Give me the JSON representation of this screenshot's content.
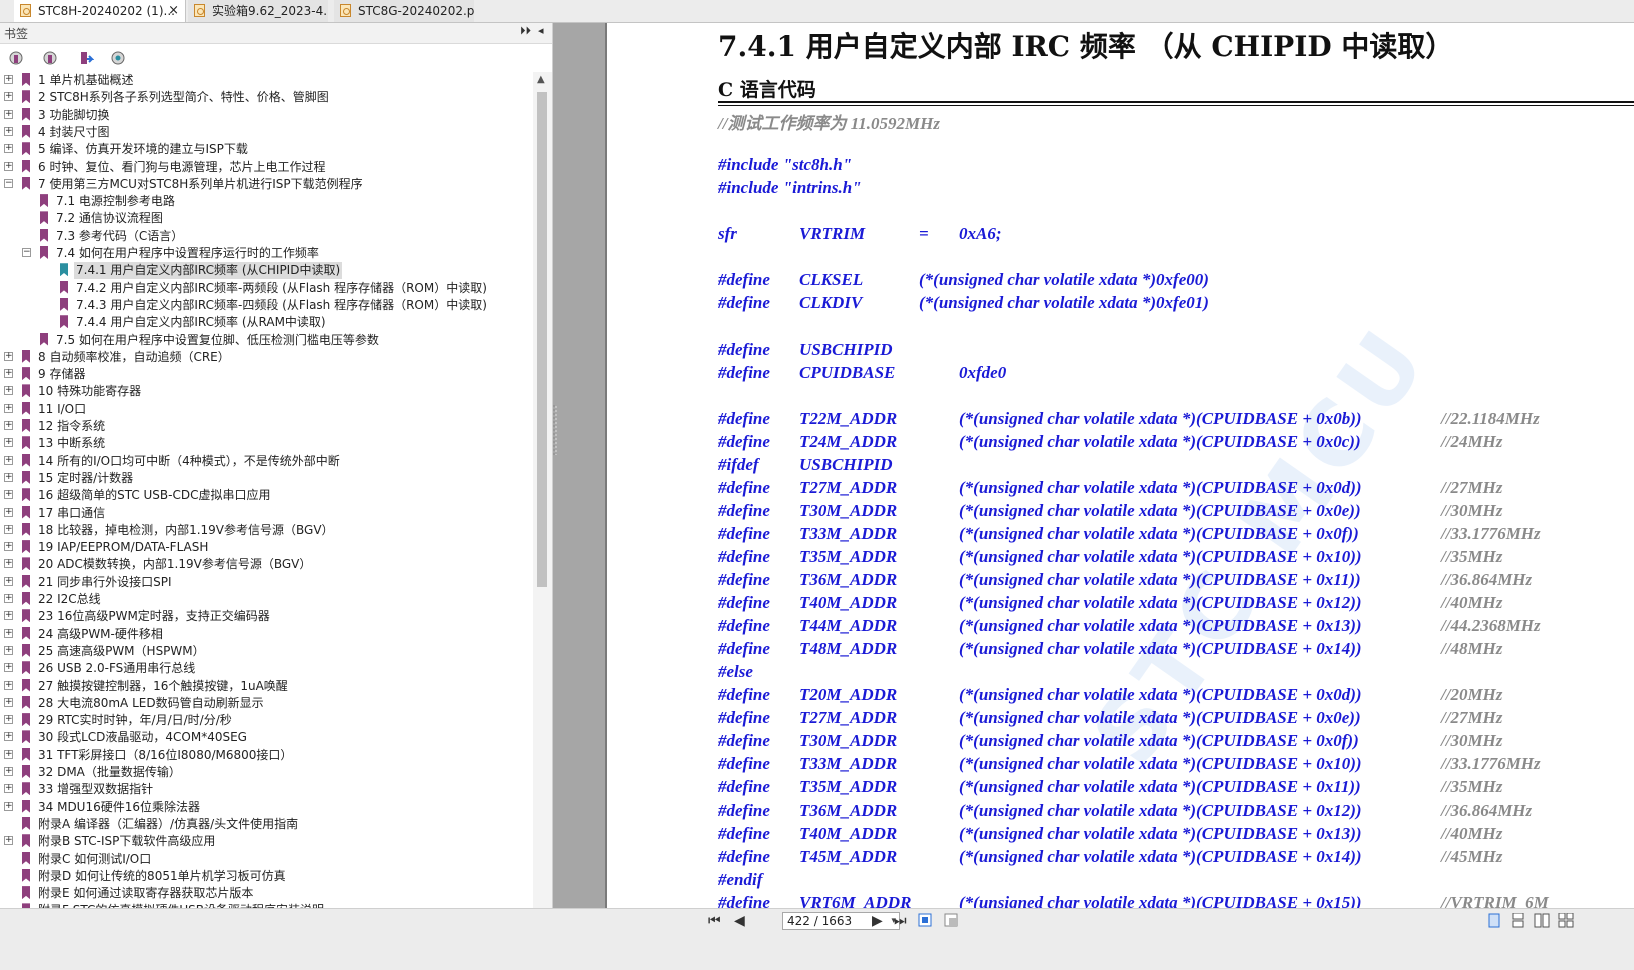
{
  "tabs": [
    {
      "label": "STC8H-20240202 (1)...",
      "active": true,
      "close": "×"
    },
    {
      "label": "实验箱9.62_2023-4...",
      "active": false
    },
    {
      "label": "STC8G-20240202.p...",
      "active": false
    }
  ],
  "bookmarks_panel": {
    "title": "书签",
    "collapse_label": "⏵⏵",
    "close_label": "◂",
    "tools": [
      "bookmark-options-icon",
      "expand-bookmark-icon",
      "go-to-bookmark-icon",
      "find-bookmark-icon"
    ]
  },
  "bookmarks": [
    {
      "label": "1 单片机基础概述",
      "level": 0,
      "exp": "+"
    },
    {
      "label": "2  STC8H系列各子系列选型简介、特性、价格、管脚图",
      "level": 0,
      "exp": "+"
    },
    {
      "label": "3  功能脚切换",
      "level": 0,
      "exp": "+"
    },
    {
      "label": "4  封装尺寸图",
      "level": 0,
      "exp": "+"
    },
    {
      "label": "5  编译、仿真开发环境的建立与ISP下载",
      "level": 0,
      "exp": "+"
    },
    {
      "label": "6  时钟、复位、看门狗与电源管理，芯片上电工作过程",
      "level": 0,
      "exp": "+"
    },
    {
      "label": "7  使用第三方MCU对STC8H系列单片机进行ISP下载范例程序",
      "level": 0,
      "exp": "−"
    },
    {
      "label": "7.1 电源控制参考电路",
      "level": 1
    },
    {
      "label": "7.2  通信协议流程图",
      "level": 1
    },
    {
      "label": "7.3  参考代码（C语言）",
      "level": 1
    },
    {
      "label": "7.4  如何在用户程序中设置程序运行时的工作频率",
      "level": 1,
      "exp": "−"
    },
    {
      "label": "7.4.1 用户自定义内部IRC频率 (从CHIPID中读取)",
      "level": 2,
      "selected": true
    },
    {
      "label": "7.4.2 用户自定义内部IRC频率-两频段 (从Flash 程序存储器（ROM）中读取)",
      "level": 2
    },
    {
      "label": "7.4.3 用户自定义内部IRC频率-四频段 (从Flash 程序存储器（ROM）中读取)",
      "level": 2
    },
    {
      "label": "7.4.4 用户自定义内部IRC频率 (从RAM中读取)",
      "level": 2
    },
    {
      "label": "7.5 如何在用户程序中设置复位脚、低压检测门槛电压等参数",
      "level": 1
    },
    {
      "label": "8  自动频率校准，自动追频（CRE）",
      "level": 0,
      "exp": "+"
    },
    {
      "label": "9  存储器",
      "level": 0,
      "exp": "+"
    },
    {
      "label": "10  特殊功能寄存器",
      "level": 0,
      "exp": "+"
    },
    {
      "label": "11  I/O口",
      "level": 0,
      "exp": "+"
    },
    {
      "label": "12  指令系统",
      "level": 0,
      "exp": "+"
    },
    {
      "label": "13  中断系统",
      "level": 0,
      "exp": "+"
    },
    {
      "label": "14  所有的I/O口均可中断（4种模式），不是传统外部中断",
      "level": 0,
      "exp": "+"
    },
    {
      "label": "15  定时器/计数器",
      "level": 0,
      "exp": "+"
    },
    {
      "label": "16  超级简单的STC USB-CDC虚拟串口应用",
      "level": 0,
      "exp": "+"
    },
    {
      "label": "17  串口通信",
      "level": 0,
      "exp": "+"
    },
    {
      "label": "18  比较器，掉电检测，内部1.19V参考信号源（BGV）",
      "level": 0,
      "exp": "+"
    },
    {
      "label": "19  IAP/EEPROM/DATA-FLASH",
      "level": 0,
      "exp": "+"
    },
    {
      "label": "20  ADC模数转换，内部1.19V参考信号源（BGV）",
      "level": 0,
      "exp": "+"
    },
    {
      "label": "21  同步串行外设接口SPI",
      "level": 0,
      "exp": "+"
    },
    {
      "label": "22  I2C总线",
      "level": 0,
      "exp": "+"
    },
    {
      "label": "23  16位高级PWM定时器，支持正交编码器",
      "level": 0,
      "exp": "+"
    },
    {
      "label": "24  高级PWM-硬件移相",
      "level": 0,
      "exp": "+"
    },
    {
      "label": "25  高速高级PWM（HSPWM）",
      "level": 0,
      "exp": "+"
    },
    {
      "label": "26  USB 2.0-FS通用串行总线",
      "level": 0,
      "exp": "+"
    },
    {
      "label": "27  触摸按键控制器，16个触摸按键，1uA唤醒",
      "level": 0,
      "exp": "+"
    },
    {
      "label": "28  大电流80mA  LED数码管自动刷新显示",
      "level": 0,
      "exp": "+"
    },
    {
      "label": "29  RTC实时时钟，年/月/日/时/分/秒",
      "level": 0,
      "exp": "+"
    },
    {
      "label": "30  段式LCD液晶驱动，4COM*40SEG",
      "level": 0,
      "exp": "+"
    },
    {
      "label": "31  TFT彩屏接口（8/16位I8080/M6800接口）",
      "level": 0,
      "exp": "+"
    },
    {
      "label": "32  DMA（批量数据传输）",
      "level": 0,
      "exp": "+"
    },
    {
      "label": "33  增强型双数据指针",
      "level": 0,
      "exp": "+"
    },
    {
      "label": "34  MDU16硬件16位乘除法器",
      "level": 0,
      "exp": "+"
    },
    {
      "label": "附录A  编译器（汇编器）/仿真器/头文件使用指南",
      "level": 0
    },
    {
      "label": "附录B  STC-ISP下载软件高级应用",
      "level": 0,
      "exp": "+"
    },
    {
      "label": "附录C  如何测试I/O口",
      "level": 0
    },
    {
      "label": "附录D  如何让传统的8051单片机学习板可仿真",
      "level": 0
    },
    {
      "label": "附录E  如何通过读取寄存器获取芯片版本",
      "level": 0
    },
    {
      "label": "附录F  STC的仿真模拟硬件USB设备驱动程序安装说明",
      "level": 0
    }
  ],
  "document": {
    "title": "7.4.1    用户自定义内部 IRC 频率 （从 CHIPID 中读取）",
    "subtitle": "C 语言代码",
    "watermark": "STC MCU",
    "code_lines": [
      {
        "parts": [
          {
            "t": "//测试工作频率为 11.0592MHz",
            "col": 0,
            "cmt": true
          }
        ]
      },
      {
        "blank": true
      },
      {
        "parts": [
          {
            "t": "#include \"stc8h.h\"",
            "col": 0
          }
        ]
      },
      {
        "parts": [
          {
            "t": "#include \"intrins.h\"",
            "col": 0
          }
        ]
      },
      {
        "blank": true
      },
      {
        "parts": [
          {
            "t": "sfr",
            "col": 0
          },
          {
            "t": "VRTRIM",
            "col": 1
          },
          {
            "t": "=",
            "col": 5
          },
          {
            "t": "0xA6;",
            "col": 6
          }
        ]
      },
      {
        "blank": true
      },
      {
        "parts": [
          {
            "t": "#define",
            "col": 0
          },
          {
            "t": "CLKSEL",
            "col": 1
          },
          {
            "t": "(*(unsigned char volatile xdata *)0xfe00)",
            "col": 2
          }
        ]
      },
      {
        "parts": [
          {
            "t": "#define",
            "col": 0
          },
          {
            "t": "CLKDIV",
            "col": 1
          },
          {
            "t": "(*(unsigned char volatile xdata *)0xfe01)",
            "col": 2
          }
        ]
      },
      {
        "blank": true
      },
      {
        "parts": [
          {
            "t": "#define",
            "col": 0
          },
          {
            "t": "USBCHIPID",
            "col": 1
          }
        ]
      },
      {
        "parts": [
          {
            "t": "#define",
            "col": 0
          },
          {
            "t": "CPUIDBASE",
            "col": 1
          },
          {
            "t": "0xfde0",
            "col": 3
          }
        ]
      },
      {
        "blank": true
      },
      {
        "parts": [
          {
            "t": "#define",
            "col": 0
          },
          {
            "t": "T22M_ADDR",
            "col": 1
          },
          {
            "t": "(*(unsigned char volatile xdata *)(CPUIDBASE + 0x0b))",
            "col": 3
          },
          {
            "t": "//22.1184MHz",
            "col": 4,
            "cmt": true
          }
        ]
      },
      {
        "parts": [
          {
            "t": "#define",
            "col": 0
          },
          {
            "t": "T24M_ADDR",
            "col": 1
          },
          {
            "t": "(*(unsigned char volatile xdata *)(CPUIDBASE + 0x0c))",
            "col": 3
          },
          {
            "t": "//24MHz",
            "col": 4,
            "cmt": true
          }
        ]
      },
      {
        "parts": [
          {
            "t": "#ifdef",
            "col": 0
          },
          {
            "t": "USBCHIPID",
            "col": 1
          }
        ]
      },
      {
        "parts": [
          {
            "t": "#define",
            "col": 0
          },
          {
            "t": "T27M_ADDR",
            "col": 1
          },
          {
            "t": "(*(unsigned char volatile xdata *)(CPUIDBASE + 0x0d))",
            "col": 3
          },
          {
            "t": "//27MHz",
            "col": 4,
            "cmt": true
          }
        ]
      },
      {
        "parts": [
          {
            "t": "#define",
            "col": 0
          },
          {
            "t": "T30M_ADDR",
            "col": 1
          },
          {
            "t": "(*(unsigned char volatile xdata *)(CPUIDBASE + 0x0e))",
            "col": 3
          },
          {
            "t": "//30MHz",
            "col": 4,
            "cmt": true
          }
        ]
      },
      {
        "parts": [
          {
            "t": "#define",
            "col": 0
          },
          {
            "t": "T33M_ADDR",
            "col": 1
          },
          {
            "t": "(*(unsigned char volatile xdata *)(CPUIDBASE + 0x0f))",
            "col": 3
          },
          {
            "t": "//33.1776MHz",
            "col": 4,
            "cmt": true
          }
        ]
      },
      {
        "parts": [
          {
            "t": "#define",
            "col": 0
          },
          {
            "t": "T35M_ADDR",
            "col": 1
          },
          {
            "t": "(*(unsigned char volatile xdata *)(CPUIDBASE + 0x10))",
            "col": 3
          },
          {
            "t": "//35MHz",
            "col": 4,
            "cmt": true
          }
        ]
      },
      {
        "parts": [
          {
            "t": "#define",
            "col": 0
          },
          {
            "t": "T36M_ADDR",
            "col": 1
          },
          {
            "t": "(*(unsigned char volatile xdata *)(CPUIDBASE + 0x11))",
            "col": 3
          },
          {
            "t": "//36.864MHz",
            "col": 4,
            "cmt": true
          }
        ]
      },
      {
        "parts": [
          {
            "t": "#define",
            "col": 0
          },
          {
            "t": "T40M_ADDR",
            "col": 1
          },
          {
            "t": "(*(unsigned char volatile xdata *)(CPUIDBASE + 0x12))",
            "col": 3
          },
          {
            "t": "//40MHz",
            "col": 4,
            "cmt": true
          }
        ]
      },
      {
        "parts": [
          {
            "t": "#define",
            "col": 0
          },
          {
            "t": "T44M_ADDR",
            "col": 1
          },
          {
            "t": "(*(unsigned char volatile xdata *)(CPUIDBASE + 0x13))",
            "col": 3
          },
          {
            "t": "//44.2368MHz",
            "col": 4,
            "cmt": true
          }
        ]
      },
      {
        "parts": [
          {
            "t": "#define",
            "col": 0
          },
          {
            "t": "T48M_ADDR",
            "col": 1
          },
          {
            "t": "(*(unsigned char volatile xdata *)(CPUIDBASE + 0x14))",
            "col": 3
          },
          {
            "t": "//48MHz",
            "col": 4,
            "cmt": true
          }
        ]
      },
      {
        "parts": [
          {
            "t": "#else",
            "col": 0
          }
        ]
      },
      {
        "parts": [
          {
            "t": "#define",
            "col": 0
          },
          {
            "t": "T20M_ADDR",
            "col": 1
          },
          {
            "t": "(*(unsigned char volatile xdata *)(CPUIDBASE + 0x0d))",
            "col": 3
          },
          {
            "t": "//20MHz",
            "col": 4,
            "cmt": true
          }
        ]
      },
      {
        "parts": [
          {
            "t": "#define",
            "col": 0
          },
          {
            "t": "T27M_ADDR",
            "col": 1
          },
          {
            "t": "(*(unsigned char volatile xdata *)(CPUIDBASE + 0x0e))",
            "col": 3
          },
          {
            "t": "//27MHz",
            "col": 4,
            "cmt": true
          }
        ]
      },
      {
        "parts": [
          {
            "t": "#define",
            "col": 0
          },
          {
            "t": "T30M_ADDR",
            "col": 1
          },
          {
            "t": "(*(unsigned char volatile xdata *)(CPUIDBASE + 0x0f))",
            "col": 3
          },
          {
            "t": "//30MHz",
            "col": 4,
            "cmt": true
          }
        ]
      },
      {
        "parts": [
          {
            "t": "#define",
            "col": 0
          },
          {
            "t": "T33M_ADDR",
            "col": 1
          },
          {
            "t": "(*(unsigned char volatile xdata *)(CPUIDBASE + 0x10))",
            "col": 3
          },
          {
            "t": "//33.1776MHz",
            "col": 4,
            "cmt": true
          }
        ]
      },
      {
        "parts": [
          {
            "t": "#define",
            "col": 0
          },
          {
            "t": "T35M_ADDR",
            "col": 1
          },
          {
            "t": "(*(unsigned char volatile xdata *)(CPUIDBASE + 0x11))",
            "col": 3
          },
          {
            "t": "//35MHz",
            "col": 4,
            "cmt": true
          }
        ]
      },
      {
        "parts": [
          {
            "t": "#define",
            "col": 0
          },
          {
            "t": "T36M_ADDR",
            "col": 1
          },
          {
            "t": "(*(unsigned char volatile xdata *)(CPUIDBASE + 0x12))",
            "col": 3
          },
          {
            "t": "//36.864MHz",
            "col": 4,
            "cmt": true
          }
        ]
      },
      {
        "parts": [
          {
            "t": "#define",
            "col": 0
          },
          {
            "t": "T40M_ADDR",
            "col": 1
          },
          {
            "t": "(*(unsigned char volatile xdata *)(CPUIDBASE + 0x13))",
            "col": 3
          },
          {
            "t": "//40MHz",
            "col": 4,
            "cmt": true
          }
        ]
      },
      {
        "parts": [
          {
            "t": "#define",
            "col": 0
          },
          {
            "t": "T45M_ADDR",
            "col": 1
          },
          {
            "t": "(*(unsigned char volatile xdata *)(CPUIDBASE + 0x14))",
            "col": 3
          },
          {
            "t": "//45MHz",
            "col": 4,
            "cmt": true
          }
        ]
      },
      {
        "parts": [
          {
            "t": "#endif",
            "col": 0
          }
        ]
      },
      {
        "parts": [
          {
            "t": "#define",
            "col": 0
          },
          {
            "t": "VRT6M_ADDR",
            "col": 1
          },
          {
            "t": "(*(unsigned char volatile xdata *)(CPUIDBASE + 0x15))",
            "col": 3
          },
          {
            "t": "//VRTRIM_6M",
            "col": 4,
            "cmt": true
          }
        ]
      }
    ]
  },
  "statusbar": {
    "first": "⏮",
    "prev": "◀",
    "page": "422 / 1663",
    "dropdown": "▾",
    "next": "▶",
    "last": "⏭",
    "tools": [
      "fit-page-icon",
      "actual-size-icon"
    ],
    "views": [
      "single-page-icon",
      "continuous-icon",
      "two-page-icon",
      "two-page-continuous-icon"
    ]
  },
  "colors": {
    "code": "#1a1ad6",
    "comment": "#8a8a8a",
    "bookmark": "#8e3f7d",
    "bookmark_current": "#2b8fa0"
  }
}
